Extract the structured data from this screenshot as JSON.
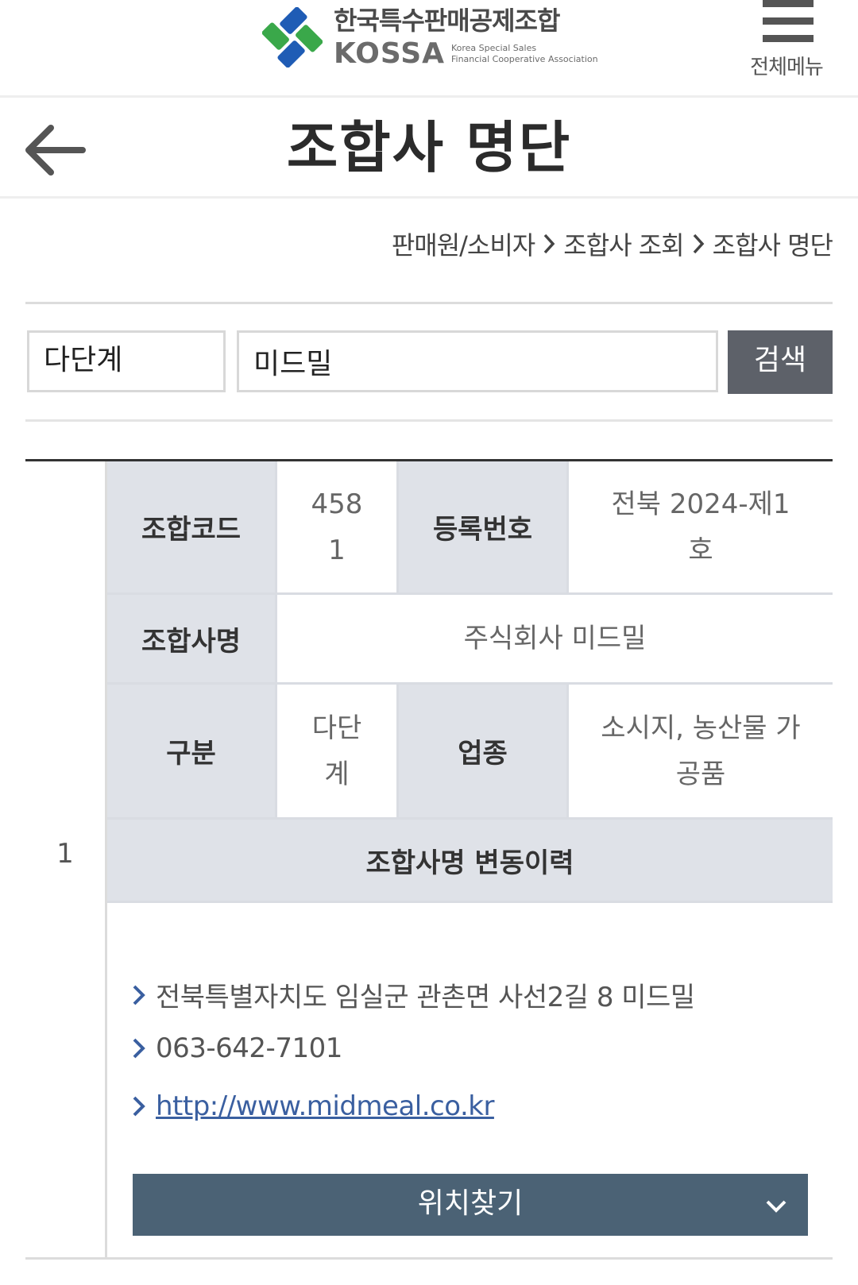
{
  "header": {
    "org_name_ko": "한국특수판매공제조합",
    "org_name_en": "KOSSA",
    "org_sub_en_1": "Korea Special Sales",
    "org_sub_en_2": "Financial Cooperative Association",
    "menu_label": "전체메뉴"
  },
  "title": {
    "text": "조합사 명단"
  },
  "breadcrumb": [
    "판매원/소비자",
    "조합사 조회",
    "조합사 명단"
  ],
  "search": {
    "category": "다단계",
    "keyword": "미드밀",
    "button_label": "검색"
  },
  "result": {
    "index": "1",
    "labels": {
      "code": "조합코드",
      "reg_no": "등록번호",
      "name": "조합사명",
      "type": "구분",
      "industry": "업종",
      "history": "조합사명 변동이력"
    },
    "code_line1": "458",
    "code_line2": "1",
    "reg_no_line1": "전북 2024-제1",
    "reg_no_line2": "호",
    "name": "주식회사 미드밀",
    "type_line1": "다단",
    "type_line2": "계",
    "industry_line1": "소시지, 농산물 가",
    "industry_line2": "공품",
    "address": "전북특별자치도 임실군 관촌면 사선2길 8 미드밀",
    "phone": "063-642-7101",
    "website": "http://www.midmeal.co.kr",
    "location_button": "위치찾기"
  },
  "colors": {
    "header_cell": "#dfe2e8",
    "search_button": "#5d6169",
    "location_button": "#4b6275",
    "link": "#3a5fa0",
    "logo_blue": "#1f5cb5",
    "logo_green": "#3aa84a"
  }
}
